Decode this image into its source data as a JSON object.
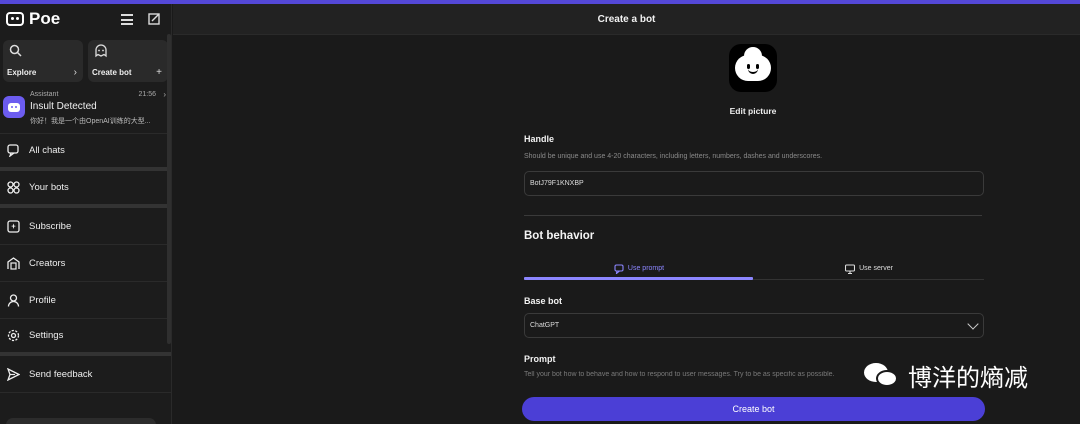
{
  "app": {
    "name": "Poe",
    "accent": "#5448d8"
  },
  "sidebar": {
    "explore_label": "Explore",
    "create_bot_label": "Create bot",
    "recent_chat": {
      "bot_type": "Assistant",
      "time": "21:56",
      "title": "Insult Detected",
      "preview": "你好！我是一个由OpenAI训练的大型..."
    },
    "nav": [
      {
        "label": "All chats",
        "icon": "chat-icon"
      },
      {
        "label": "Your bots",
        "icon": "bots-grid-icon"
      },
      {
        "label": "Subscribe",
        "icon": "subscribe-icon"
      },
      {
        "label": "Creators",
        "icon": "creators-icon"
      },
      {
        "label": "Profile",
        "icon": "profile-icon"
      },
      {
        "label": "Settings",
        "icon": "gear-icon"
      },
      {
        "label": "Send feedback",
        "icon": "send-icon"
      }
    ]
  },
  "main": {
    "header_title": "Create a bot",
    "edit_picture_label": "Edit picture",
    "handle": {
      "label": "Handle",
      "hint": "Should be unique and use 4-20 characters, including letters, numbers, dashes and underscores.",
      "value": "BotJ79F1KNXBP"
    },
    "bot_behavior": {
      "title": "Bot behavior",
      "tabs": [
        {
          "label": "Use prompt",
          "active": true
        },
        {
          "label": "Use server",
          "active": false
        }
      ],
      "base_bot_label": "Base bot",
      "base_bot_value": "ChatGPT",
      "prompt_label": "Prompt",
      "prompt_hint": "Tell your bot how to behave and how to respond to user messages. Try to be as specific as possible."
    },
    "create_button_label": "Create bot"
  },
  "watermark": {
    "text": "博洋的熵减"
  }
}
